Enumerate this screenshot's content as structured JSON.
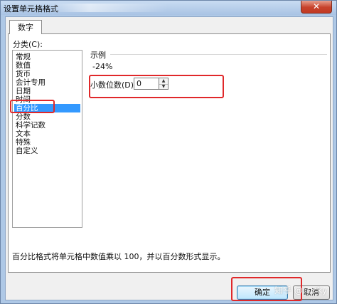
{
  "window": {
    "title": "设置单元格格式",
    "close_symbol": "✕"
  },
  "tabs": [
    {
      "label": "数字"
    }
  ],
  "category": {
    "label": "分类(C):",
    "items": [
      {
        "label": "常规"
      },
      {
        "label": "数值"
      },
      {
        "label": "货币"
      },
      {
        "label": "会计专用"
      },
      {
        "label": "日期"
      },
      {
        "label": "时间"
      },
      {
        "label": "百分比"
      },
      {
        "label": "分数"
      },
      {
        "label": "科学记数"
      },
      {
        "label": "文本"
      },
      {
        "label": "特殊"
      },
      {
        "label": "自定义"
      }
    ],
    "selected": "百分比"
  },
  "sample": {
    "label": "示例",
    "value": "-24%"
  },
  "decimals": {
    "label": "小数位数(D):",
    "value": "0"
  },
  "description": "百分比格式将单元格中数值乘以 100，并以百分数形式显示。",
  "buttons": {
    "ok": "确定",
    "cancel": "取消"
  },
  "watermark": "知乎 @Lucky",
  "colors": {
    "highlight": "#e0282a",
    "selection": "#3399ff"
  }
}
